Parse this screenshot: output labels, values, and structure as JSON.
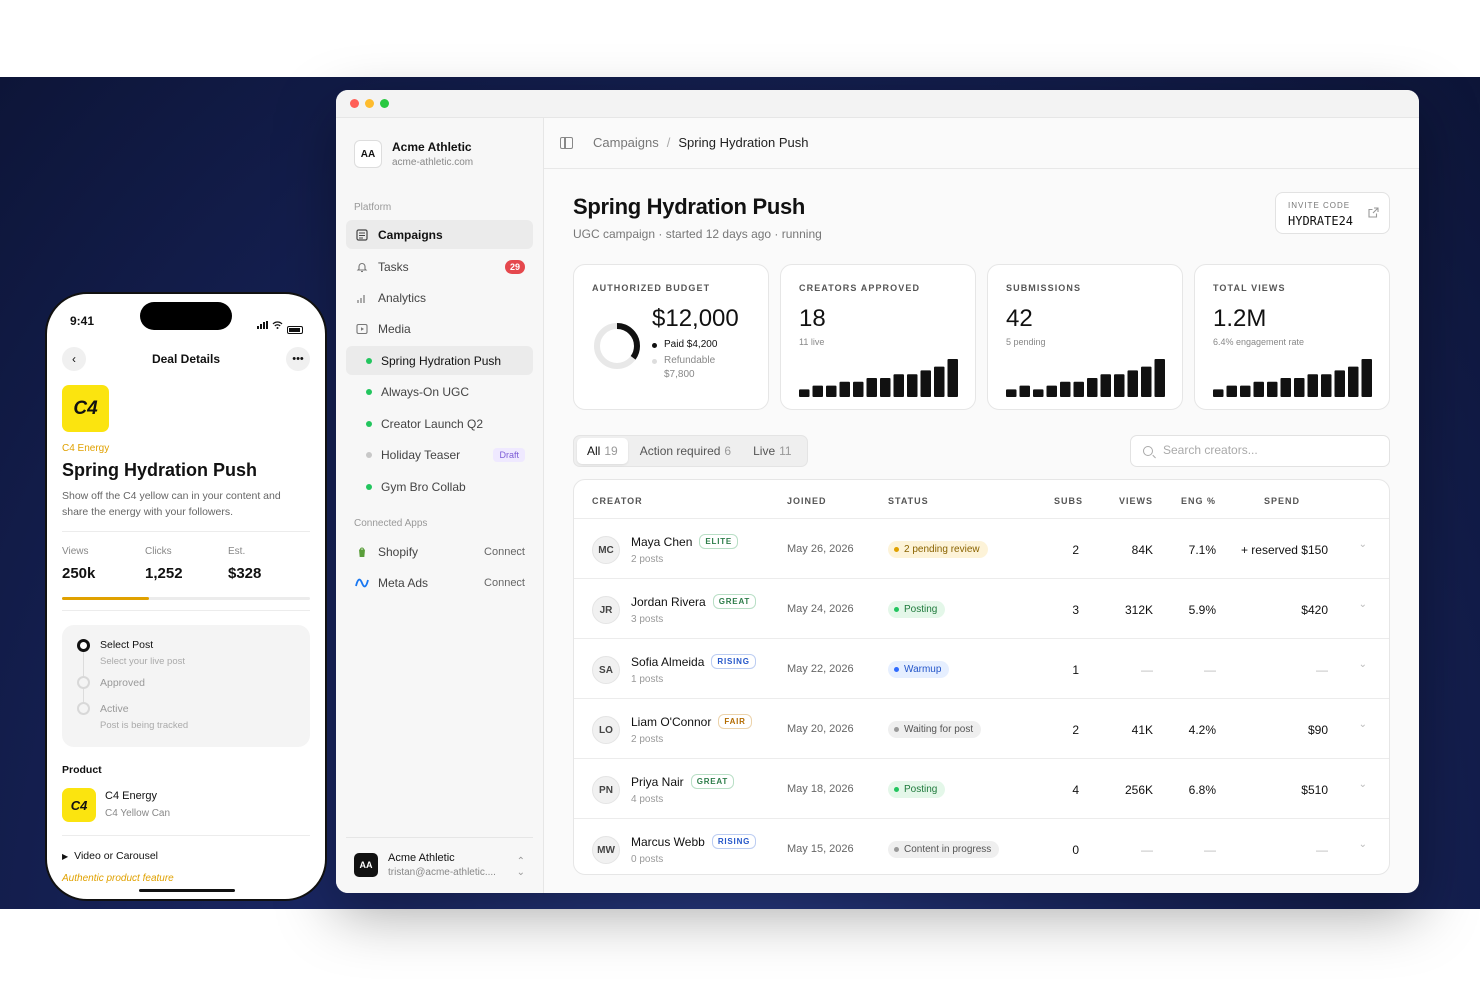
{
  "app": {
    "org_name": "Acme Athletic",
    "org_domain": "acme-athletic.com",
    "org_initials": "AA"
  },
  "sidebar": {
    "platform_label": "Platform",
    "nav": [
      {
        "label": "Campaigns",
        "icon": "campaigns-icon"
      },
      {
        "label": "Tasks",
        "icon": "bell-icon",
        "badge": "29"
      },
      {
        "label": "Analytics",
        "icon": "chart-icon"
      },
      {
        "label": "Media",
        "icon": "media-icon"
      }
    ],
    "campaigns": [
      {
        "label": "Spring Hydration Push",
        "active": true
      },
      {
        "label": "Always-On UGC"
      },
      {
        "label": "Creator Launch Q2"
      },
      {
        "label": "Holiday Teaser",
        "badge": "Draft"
      },
      {
        "label": "Gym Bro Collab"
      }
    ],
    "connected_label": "Connected Apps",
    "apps": [
      {
        "label": "Shopify",
        "action": "Connect",
        "icon": "shopify-icon"
      },
      {
        "label": "Meta Ads",
        "action": "Connect",
        "icon": "meta-icon"
      }
    ],
    "footer": {
      "initials": "AA",
      "name": "Acme Athletic",
      "email": "tristan@acme-athletic...."
    }
  },
  "breadcrumb": {
    "parent": "Campaigns",
    "separator": "/",
    "current": "Spring Hydration Push"
  },
  "header": {
    "title": "Spring Hydration Push",
    "subtitle": "UGC campaign · started 12 days ago · running",
    "invite_label": "INVITE CODE",
    "invite_code": "HYDRATE24"
  },
  "stats": {
    "budget": {
      "label": "AUTHORIZED BUDGET",
      "value": "$12,000",
      "paid": "Paid $4,200",
      "refundable_label": "Refundable",
      "refundable_value": "$7,800",
      "paid_fraction": 0.35
    },
    "creators": {
      "label": "CREATORS APPROVED",
      "value": "18",
      "sub": "11 live",
      "bars": [
        2,
        3,
        3,
        4,
        4,
        5,
        5,
        6,
        6,
        7,
        8,
        10
      ]
    },
    "submissions": {
      "label": "SUBMISSIONS",
      "value": "42",
      "sub": "5 pending",
      "bars": [
        2,
        3,
        2,
        3,
        4,
        4,
        5,
        6,
        6,
        7,
        8,
        10
      ]
    },
    "views": {
      "label": "TOTAL VIEWS",
      "value": "1.2M",
      "sub": "6.4% engagement rate",
      "bars": [
        2,
        3,
        3,
        4,
        4,
        5,
        5,
        6,
        6,
        7,
        8,
        10
      ]
    }
  },
  "filters": {
    "tabs": [
      {
        "label": "All",
        "count": "19",
        "active": true
      },
      {
        "label": "Action required",
        "count": "6"
      },
      {
        "label": "Live",
        "count": "11"
      }
    ],
    "search_placeholder": "Search creators..."
  },
  "table": {
    "columns": {
      "creator": "CREATOR",
      "joined": "JOINED",
      "status": "STATUS",
      "subs": "SUBS",
      "views": "VIEWS",
      "eng": "ENG %",
      "spend": "SPEND"
    },
    "rows": [
      {
        "initials": "MC",
        "name": "Maya Chen",
        "tier": "ELITE",
        "posts": "2 posts",
        "joined": "May 26, 2026",
        "status": "2 pending review",
        "status_kind": "pending",
        "subs": "2",
        "views": "84K",
        "eng": "7.1%",
        "spend": "+ reserved $150"
      },
      {
        "initials": "JR",
        "name": "Jordan Rivera",
        "tier": "GREAT",
        "posts": "3 posts",
        "joined": "May 24, 2026",
        "status": "Posting",
        "status_kind": "posting",
        "subs": "3",
        "views": "312K",
        "eng": "5.9%",
        "spend": "$420"
      },
      {
        "initials": "SA",
        "name": "Sofia Almeida",
        "tier": "RISING",
        "posts": "1 posts",
        "joined": "May 22, 2026",
        "status": "Warmup",
        "status_kind": "warmup",
        "subs": "1",
        "views": "—",
        "eng": "—",
        "spend": "—"
      },
      {
        "initials": "LO",
        "name": "Liam O'Connor",
        "tier": "FAIR",
        "posts": "2 posts",
        "joined": "May 20, 2026",
        "status": "Waiting for post",
        "status_kind": "waiting",
        "subs": "2",
        "views": "41K",
        "eng": "4.2%",
        "spend": "$90"
      },
      {
        "initials": "PN",
        "name": "Priya Nair",
        "tier": "GREAT",
        "posts": "4 posts",
        "joined": "May 18, 2026",
        "status": "Posting",
        "status_kind": "posting",
        "subs": "4",
        "views": "256K",
        "eng": "6.8%",
        "spend": "$510"
      },
      {
        "initials": "MW",
        "name": "Marcus Webb",
        "tier": "RISING",
        "posts": "0 posts",
        "joined": "May 15, 2026",
        "status": "Content in progress",
        "status_kind": "waiting",
        "subs": "0",
        "views": "—",
        "eng": "—",
        "spend": "—"
      }
    ]
  },
  "phone": {
    "time": "9:41",
    "title": "Deal Details",
    "logo_text": "C4",
    "brand": "C4 Energy",
    "campaign": "Spring Hydration Push",
    "description": "Show off the C4 yellow can in your content and share the energy with your followers.",
    "stats": [
      {
        "label": "Views",
        "value": "250k"
      },
      {
        "label": "Clicks",
        "value": "1,252"
      },
      {
        "label": "Est.",
        "value": "$328"
      }
    ],
    "progress": 0.35,
    "steps": [
      {
        "title": "Select Post",
        "sub": "Select your live post",
        "active": true
      },
      {
        "title": "Approved",
        "sub": ""
      },
      {
        "title": "Active",
        "sub": "Post is being tracked"
      }
    ],
    "product_label": "Product",
    "product_name": "C4 Energy",
    "product_sub": "C4 Yellow Can",
    "video_label": "Video or Carousel",
    "video_hint": "Authentic product feature"
  },
  "colors": {
    "accent_yellow": "#fbe40f",
    "brand_text": "#e0a100",
    "live_green": "#22c55e",
    "badge_red": "#e5484d"
  }
}
